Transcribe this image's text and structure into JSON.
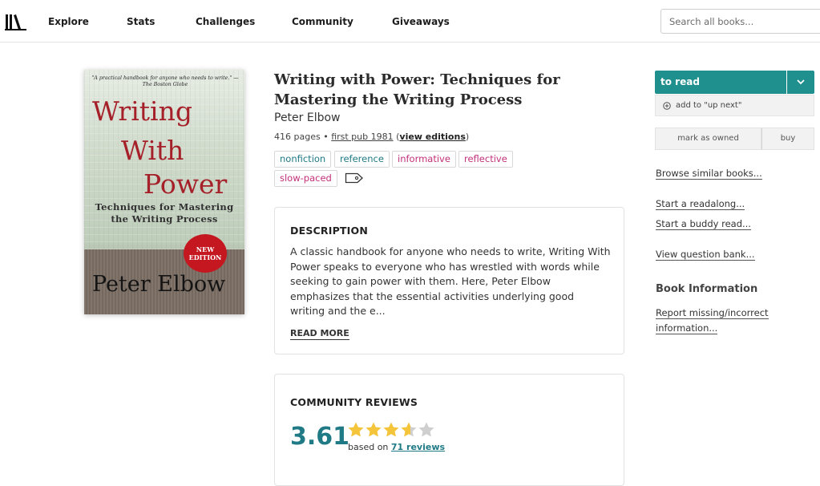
{
  "nav": {
    "items": [
      "Explore",
      "Stats",
      "Challenges",
      "Community",
      "Giveaways"
    ],
    "search_placeholder": "Search all books..."
  },
  "cover": {
    "quote": "\"A practical handbook for anyone who needs to write.\" —The Boston Globe",
    "title_line1": "Writing",
    "title_line2": "With",
    "title_line3": "Power",
    "subtitle_line1": "Techniques for Mastering",
    "subtitle_line2": "the Writing Process",
    "badge_line1": "NEW",
    "badge_line2": "EDITION",
    "author": "Peter Elbow"
  },
  "book": {
    "title": "Writing with Power: Techniques for Mastering the Writing Process",
    "author": "Peter Elbow",
    "pages": "416 pages",
    "separator": " • ",
    "first_pub": "first pub 1981",
    "paren_open": " (",
    "view_editions": "view editions",
    "paren_close": ")",
    "tags": [
      {
        "label": "nonfiction",
        "color": "#1f7a85"
      },
      {
        "label": "reference",
        "color": "#1f7a85"
      },
      {
        "label": "informative",
        "color": "#c2307a"
      },
      {
        "label": "reflective",
        "color": "#c2307a"
      },
      {
        "label": "slow-paced",
        "color": "#c2307a"
      }
    ]
  },
  "description": {
    "heading": "DESCRIPTION",
    "text": "A classic handbook for anyone who needs to write, Writing With Power speaks to everyone who has wrestled with words while seeking to gain power with them. Here, Peter Elbow emphasizes that the essential activities underlying good writing and the e...",
    "read_more": "READ MORE"
  },
  "reviews": {
    "heading": "COMMUNITY REVIEWS",
    "rating": "3.61",
    "rating_value": 3.61,
    "based_on": "based on ",
    "reviews_link": "71 reviews"
  },
  "sidebar": {
    "to_read": "to read",
    "up_next": "add to \"up next\"",
    "mark_owned": "mark as owned",
    "buy": "buy",
    "browse_similar": "Browse similar books...",
    "readalong": "Start a readalong...",
    "buddy_read": "Start a buddy read...",
    "question_bank": "View question bank...",
    "info_heading": "Book Information",
    "report_line1": "Report missing/incorrect",
    "report_line2": "information..."
  },
  "colors": {
    "accent": "#20908f",
    "rating": "#1f7a85",
    "star": "#f4c43a",
    "star_empty": "#cfcfcf",
    "cover_title": "#a6202a"
  }
}
